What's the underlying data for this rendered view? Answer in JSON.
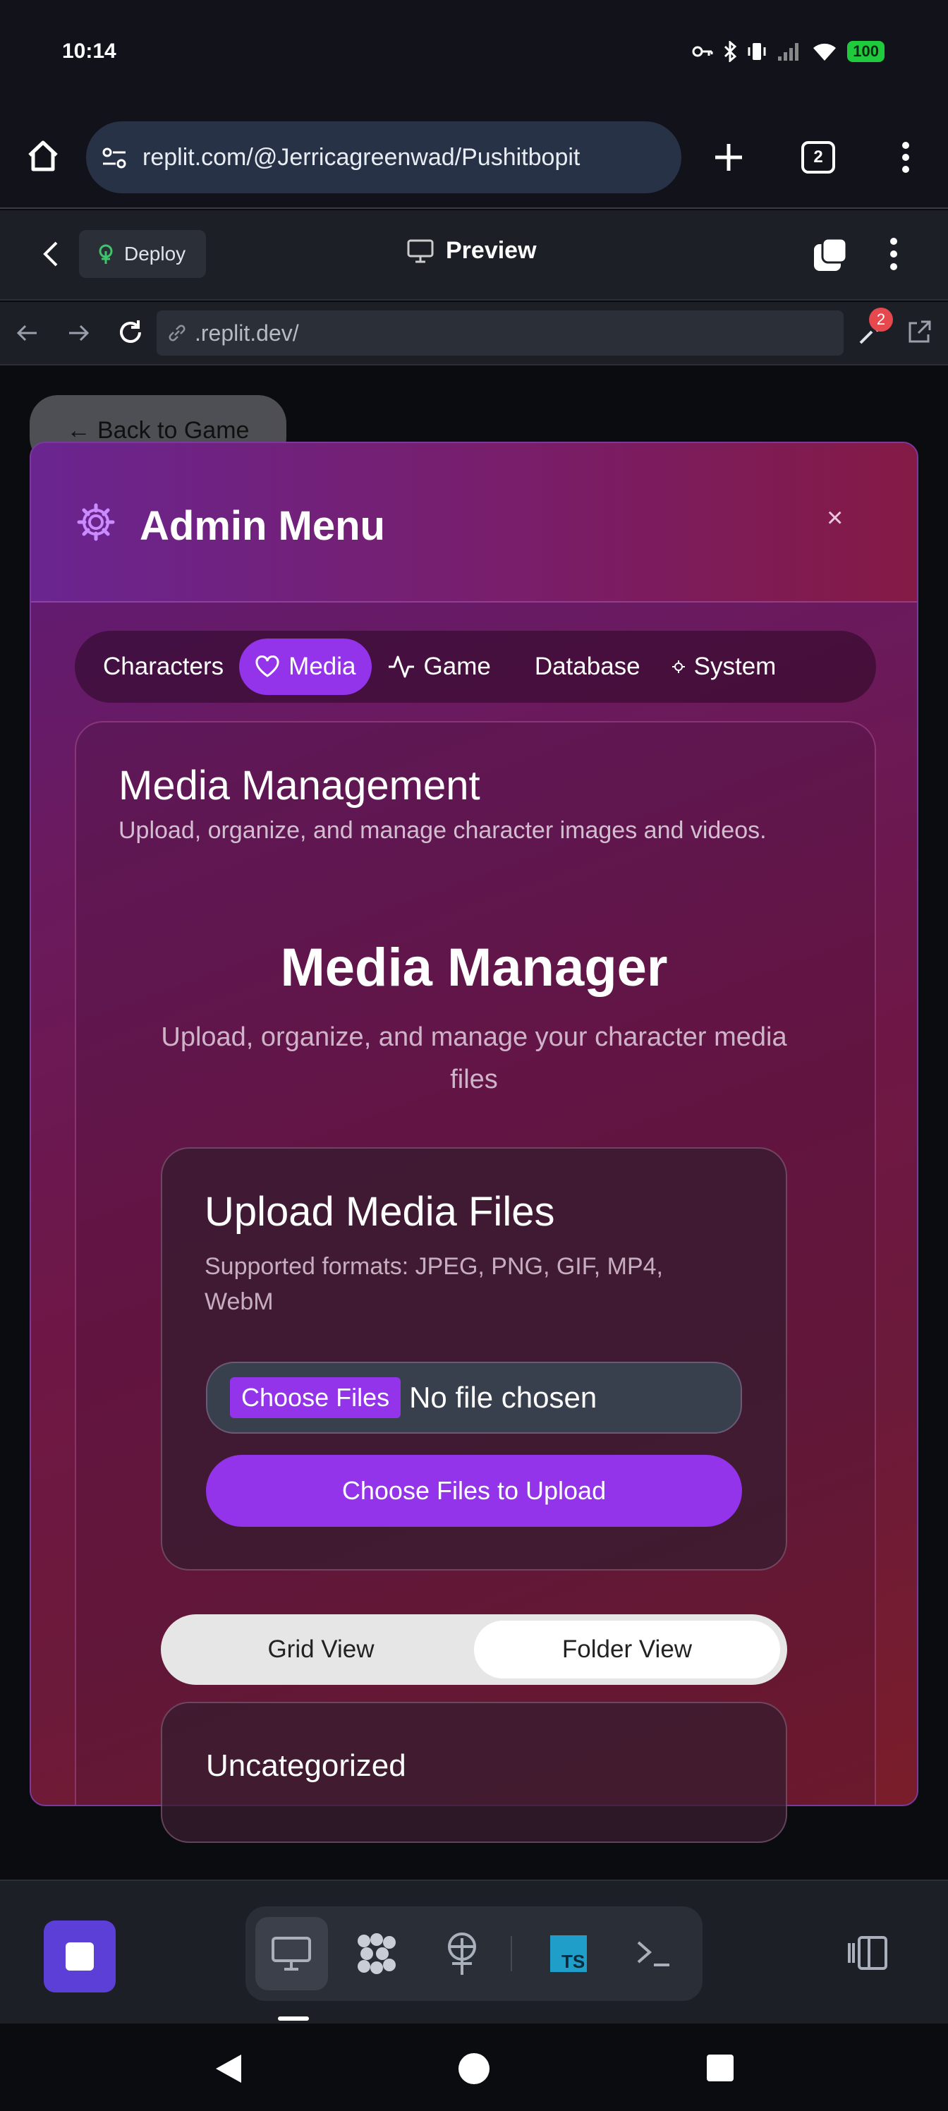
{
  "status": {
    "time": "10:14",
    "battery": "100"
  },
  "browser": {
    "url": "replit.com/@Jerricagreenwad/Pushitbopit",
    "tab_count": "2"
  },
  "replit": {
    "deploy_label": "Deploy",
    "preview_label": "Preview",
    "webview_url": ".replit.dev/",
    "devtools_badge": "2"
  },
  "page": {
    "back_button": "← Back to Game",
    "modal": {
      "title": "Admin Menu",
      "close": "×",
      "tabs": [
        {
          "label": "Characters",
          "icon": "none"
        },
        {
          "label": "Media",
          "icon": "heart-icon"
        },
        {
          "label": "Game",
          "icon": "activity-icon"
        },
        {
          "label": "Database",
          "icon": "none"
        },
        {
          "label": "System",
          "icon": "gear-small-icon"
        }
      ],
      "active_tab": "Media",
      "panel_title": "Media Management",
      "panel_subtitle": "Upload, organize, and manage character images and videos.",
      "manager_title": "Media Manager",
      "manager_subtitle": "Upload, organize, and manage your character media files",
      "upload": {
        "title": "Upload Media Files",
        "subtitle": "Supported formats: JPEG, PNG, GIF, MP4, WebM",
        "choose_button": "Choose Files",
        "no_file": "No file chosen",
        "upload_button": "Choose Files to Upload"
      },
      "views": [
        {
          "label": "Grid View"
        },
        {
          "label": "Folder View"
        }
      ],
      "active_view": "Folder View",
      "section_title": "Uncategorized"
    }
  },
  "colors": {
    "accent": "#9333ea",
    "modal_top": "#6a2590",
    "modal_bottom": "#7a1d2a"
  }
}
